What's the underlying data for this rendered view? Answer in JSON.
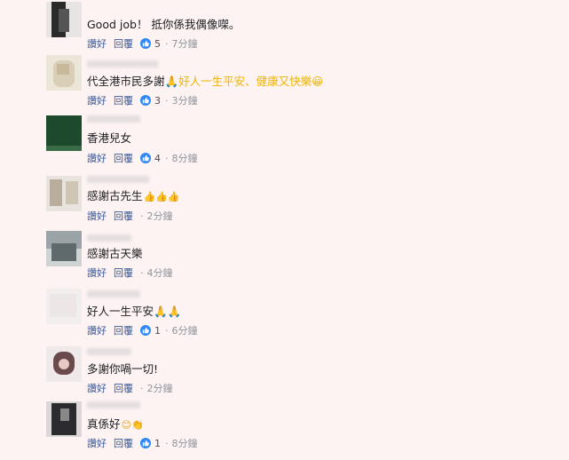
{
  "actions": {
    "like_label": "讚好",
    "reply_label": "回覆",
    "separator": "·"
  },
  "comments": [
    {
      "text": "Good job！ 抵你係我偶像㗎。",
      "emoji": "",
      "likes": "5",
      "time": "7分鐘"
    },
    {
      "text": "代全港市民多謝",
      "emoji": "🙏好人一生平安、健康又快樂😀",
      "likes": "3",
      "time": "3分鐘"
    },
    {
      "text": "香港兒女",
      "emoji": "",
      "likes": "4",
      "time": "8分鐘"
    },
    {
      "text": "感謝古先生",
      "emoji": "👍👍👍",
      "likes": "",
      "time": "2分鐘"
    },
    {
      "text": "感謝古天樂",
      "emoji": "",
      "likes": "",
      "time": "4分鐘"
    },
    {
      "text": "好人一生平安",
      "emoji": "🙏🙏",
      "likes": "1",
      "time": "6分鐘"
    },
    {
      "text": "多謝你喎一切!",
      "emoji": "",
      "likes": "",
      "time": "2分鐘"
    },
    {
      "text": "真係好",
      "emoji": "😊👏",
      "likes": "1",
      "time": "8分鐘"
    }
  ],
  "colors": {
    "background": "#fdf3f3",
    "link": "#385898",
    "like_badge": "#2f88f6",
    "meta": "#90949c"
  }
}
